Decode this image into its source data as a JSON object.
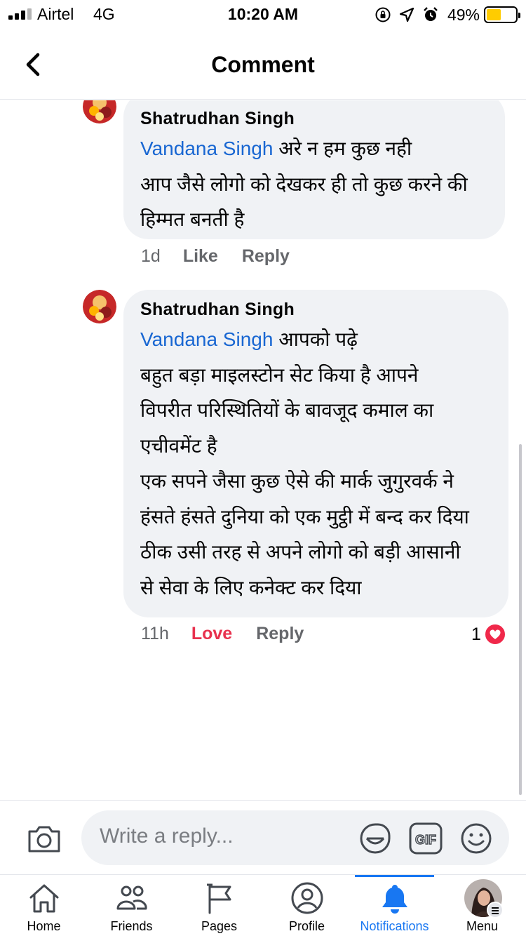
{
  "status_bar": {
    "carrier": "Airtel",
    "network": "4G",
    "time": "10:20 AM",
    "battery_percent": "49%",
    "battery_level": 0.49,
    "battery_color": "#ffcc00",
    "icons": [
      "signal-bars-icon",
      "orientation-lock-icon",
      "location-arrow-icon",
      "alarm-icon",
      "battery-icon"
    ]
  },
  "header": {
    "title": "Comment",
    "back_icon": "chevron-left-icon"
  },
  "comments": [
    {
      "author": "Shatrudhan Singh",
      "mention": "Vandana Singh",
      "lines": [
        "अरे न हम कुछ नही",
        "आप जैसे लोगो को देखकर ही तो कुछ करने की",
        "हिम्मत बनती है"
      ],
      "time": "1d",
      "like_label": "Like",
      "reply_label": "Reply"
    },
    {
      "author": "Shatrudhan Singh",
      "mention": "Vandana Singh",
      "lines": [
        "आपको पढ़े",
        "बहुत बड़ा माइलस्टोन सेट किया है आपने",
        "विपरीत परिस्थितियों के बावजूद कमाल का",
        "एचीवमेंट है",
        "एक सपने जैसा कुछ ऐसे की मार्क जुगुरवर्क ने",
        "हंसते हंसते दुनिया को एक मुट्ठी में बन्द कर दिया",
        "ठीक उसी तरह से अपने लोगो को बड़ी आसानी",
        "से सेवा के लिए कनेक्ट कर दिया"
      ],
      "time": "11h",
      "like_label": "Love",
      "reply_label": "Reply",
      "reaction_count": "1",
      "reaction_icon": "heart-icon"
    }
  ],
  "composer": {
    "placeholder": "Write a reply...",
    "gif_label": "GIF",
    "icons": [
      "camera-icon",
      "sticker-icon",
      "gif-icon",
      "emoji-icon"
    ]
  },
  "tabbar": {
    "tabs": [
      {
        "label": "Home",
        "icon": "home-icon"
      },
      {
        "label": "Friends",
        "icon": "friends-icon"
      },
      {
        "label": "Pages",
        "icon": "flag-icon"
      },
      {
        "label": "Profile",
        "icon": "profile-icon"
      },
      {
        "label": "Notifications",
        "icon": "bell-icon",
        "active": true
      },
      {
        "label": "Menu",
        "icon": "avatar-menu-icon"
      }
    ],
    "active_color": "#1877f2"
  },
  "colors": {
    "mention": "#1967d2",
    "love": "#e8314e",
    "bubble": "#f0f2f5",
    "secondary_text": "#65676b"
  }
}
